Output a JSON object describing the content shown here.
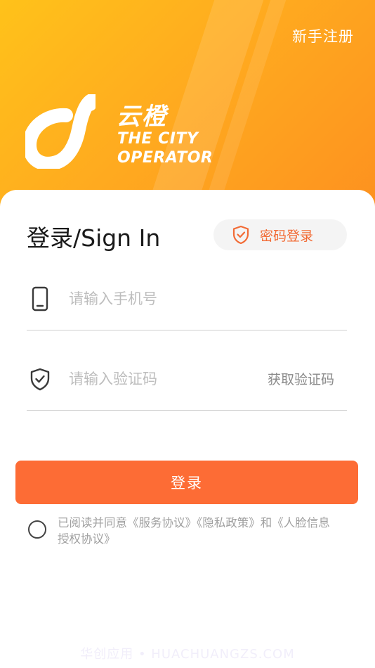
{
  "header": {
    "register_label": "新手注册",
    "brand_cn": "云橙",
    "brand_en_line1": "THE CITY",
    "brand_en_line2": "OPERATOR",
    "gradient_start": "#ffc21a",
    "gradient_end": "#fd901f"
  },
  "login": {
    "title": "登录/Sign In",
    "password_login_label": "密码登录",
    "password_login_icon": "shield-check-icon",
    "phone_placeholder": "请输入手机号",
    "phone_icon": "phone-icon",
    "code_placeholder": "请输入验证码",
    "code_icon": "shield-check-icon",
    "get_code_label": "获取验证码",
    "submit_label": "登录",
    "accent_color": "#fd6c35"
  },
  "agreement": {
    "checked": false,
    "prefix": "已阅读并同意",
    "service_link": "《服务协议》",
    "privacy_link": "《隐私政策》",
    "and": "和",
    "face_link": "《人脸信息授权协议》"
  },
  "watermark": "华创应用 • HUACHUANGZS.COM"
}
